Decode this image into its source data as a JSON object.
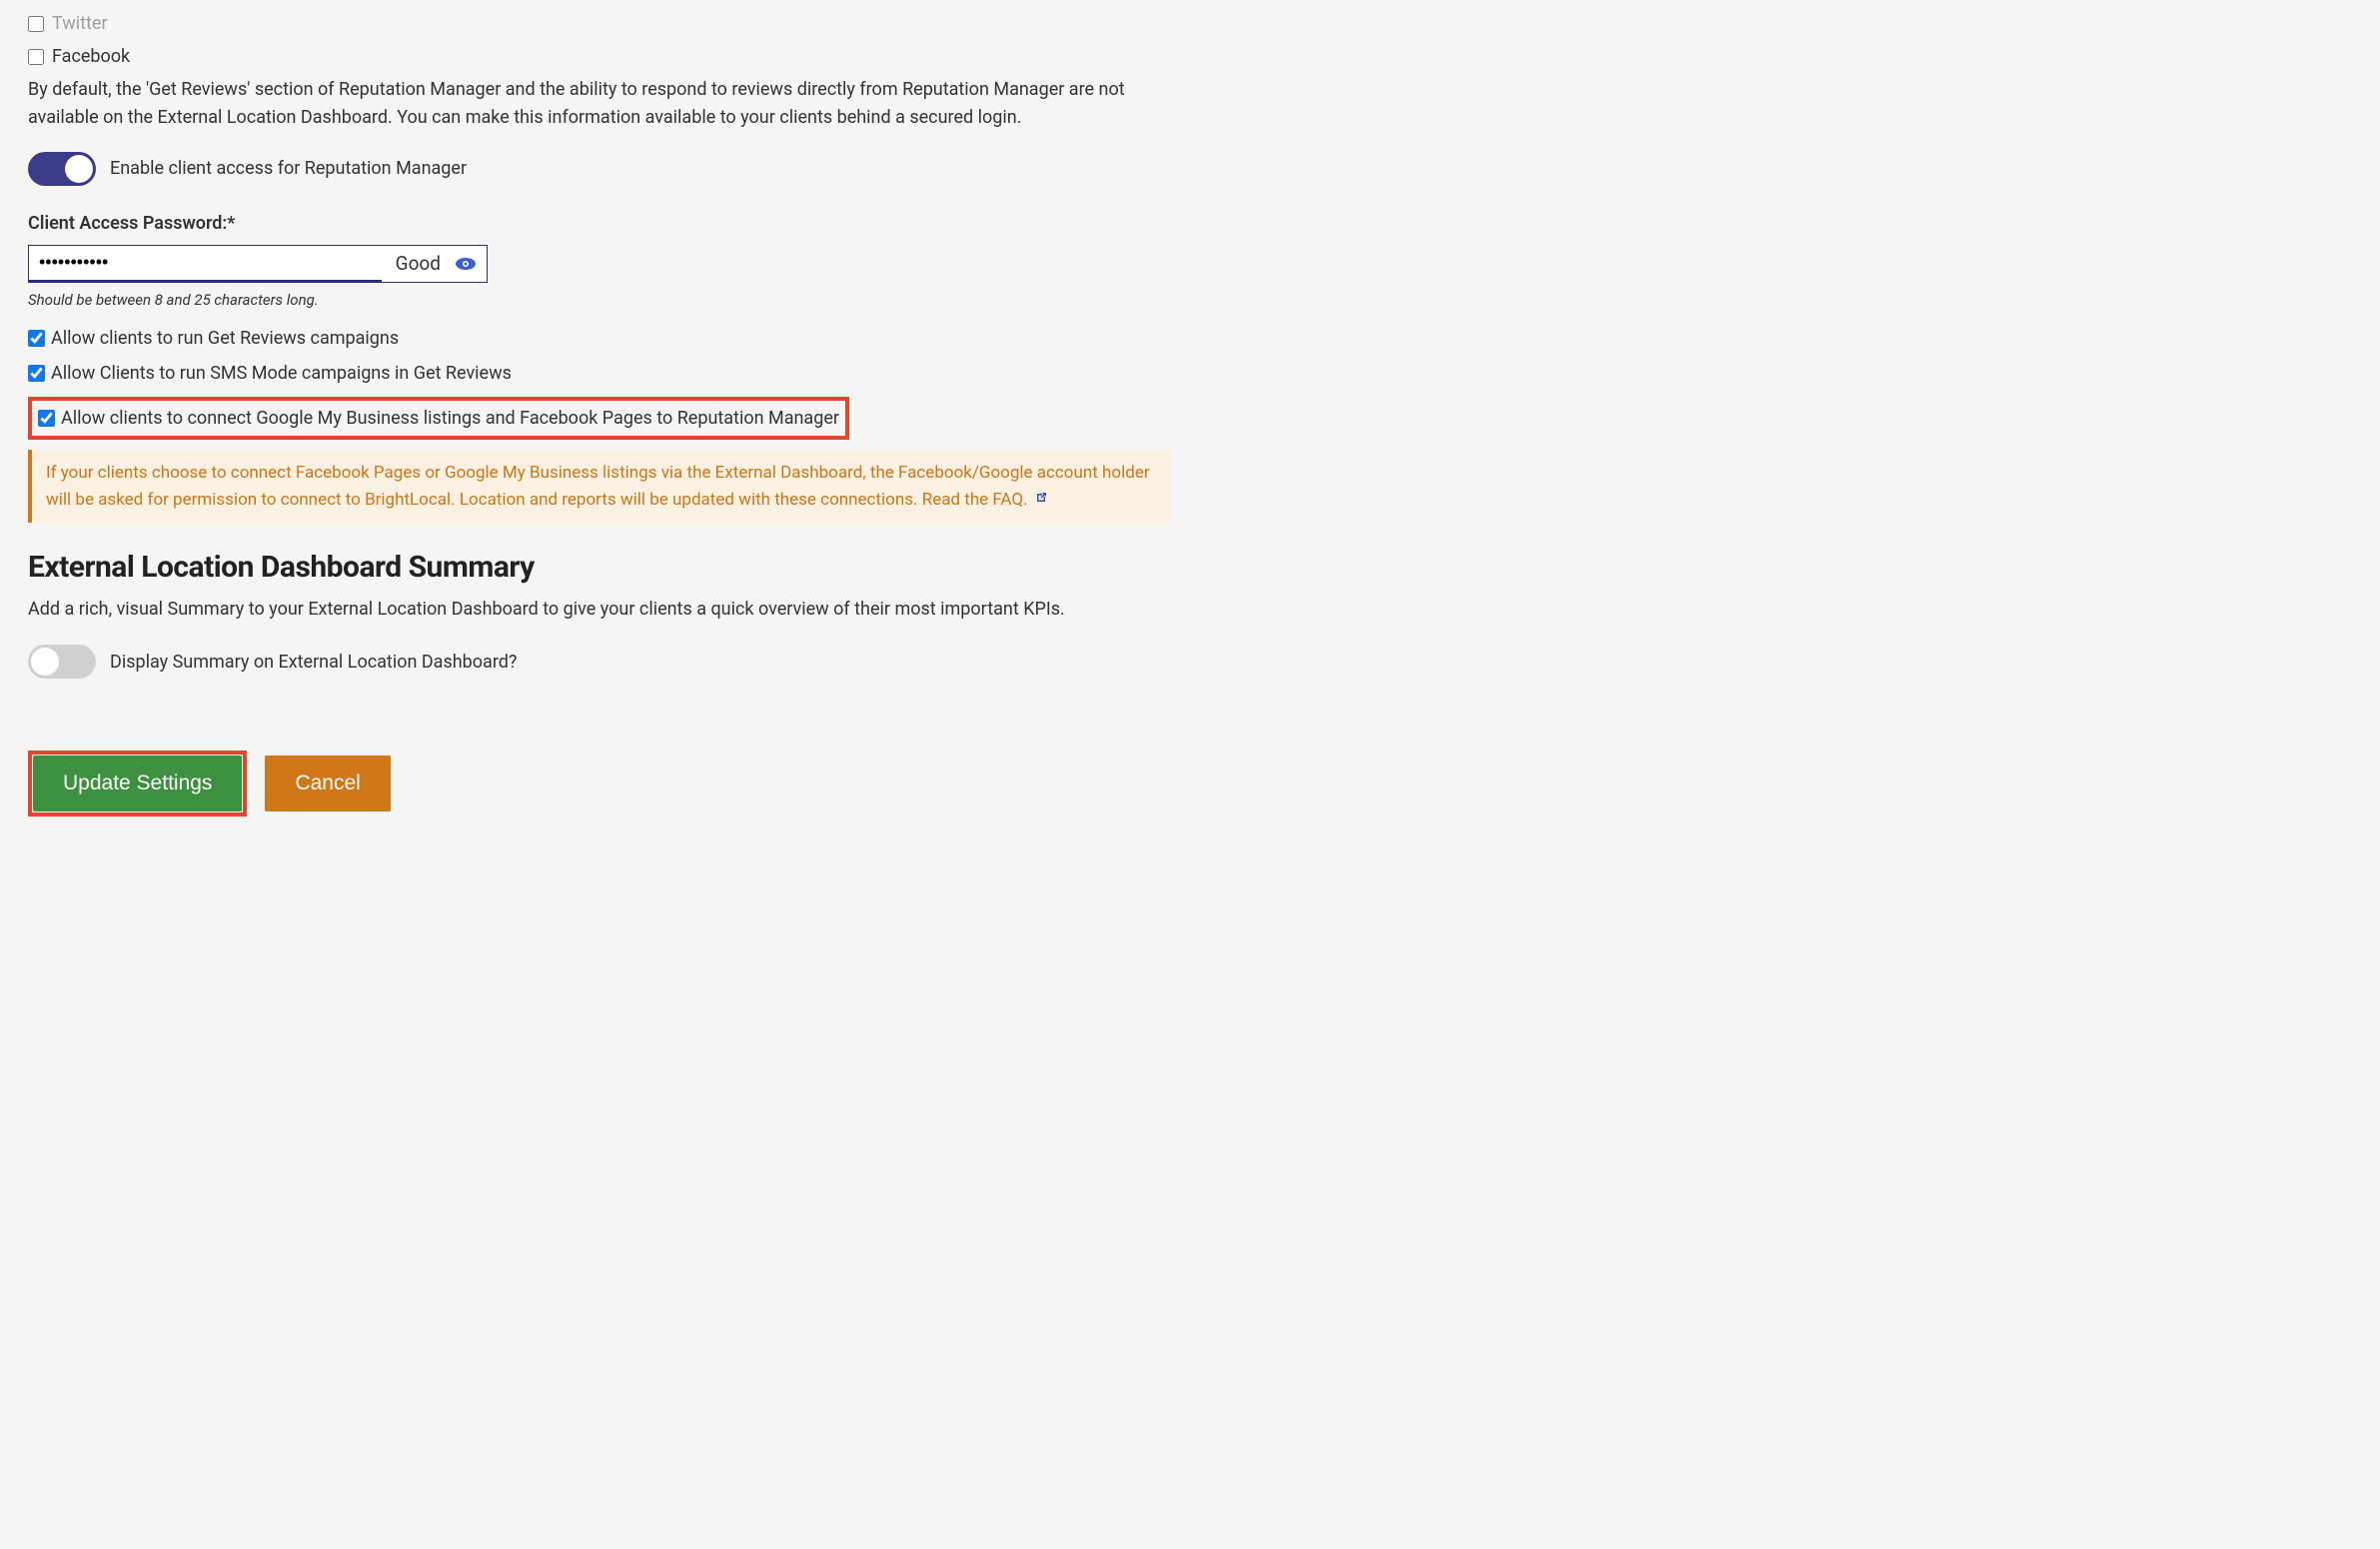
{
  "social": {
    "twitter": {
      "label": "Twitter",
      "checked": false
    },
    "facebook": {
      "label": "Facebook",
      "checked": false
    }
  },
  "description": "By default, the 'Get Reviews' section of Reputation Manager and the ability to respond to reviews directly from Reputation Manager are not available on the External Location Dashboard. You can make this information available to your clients behind a secured login.",
  "toggle_reputation": {
    "label": "Enable client access for Reputation Manager",
    "on": true
  },
  "password": {
    "label": "Client Access Password:*",
    "value": "•••••••••••",
    "strength": "Good",
    "hint": "Should be between 8 and 25 characters long."
  },
  "options": {
    "opt1": {
      "label": "Allow clients to run Get Reviews campaigns",
      "checked": true
    },
    "opt2": {
      "label": "Allow Clients to run SMS Mode campaigns in Get Reviews",
      "checked": true
    },
    "opt3": {
      "label": "Allow clients to connect Google My Business listings and Facebook Pages to Reputation Manager",
      "checked": true
    }
  },
  "info_box": {
    "text": "If your clients choose to connect Facebook Pages or Google My Business listings via the External Dashboard, the Facebook/Google account holder will be asked for permission to connect to BrightLocal. Location and reports will be updated with these connections. ",
    "link": "Read the FAQ."
  },
  "summary_section": {
    "heading": "External Location Dashboard Summary",
    "description": "Add a rich, visual Summary to your External Location Dashboard to give your clients a quick overview of their most important KPIs.",
    "toggle_label": "Display Summary on External Location Dashboard?",
    "toggle_on": false
  },
  "buttons": {
    "update": "Update Settings",
    "cancel": "Cancel"
  }
}
